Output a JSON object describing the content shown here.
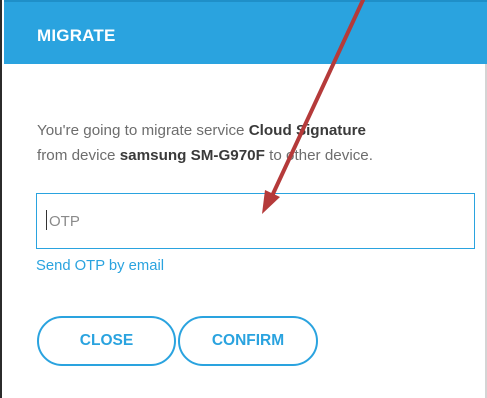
{
  "dialog": {
    "title": "MIGRATE",
    "message": {
      "prefix": "You're going to migrate service ",
      "service_name": "Cloud Signature",
      "middle": "from device ",
      "device_name": "samsung SM-G970F",
      "suffix": " to other device."
    },
    "otp_input": {
      "placeholder": "OTP",
      "value": ""
    },
    "send_otp_link": "Send OTP by email",
    "buttons": {
      "close_label": "CLOSE",
      "confirm_label": "CONFIRM"
    }
  },
  "colors": {
    "accent": "#2aa3df",
    "annotation_arrow": "#b53a3a"
  }
}
